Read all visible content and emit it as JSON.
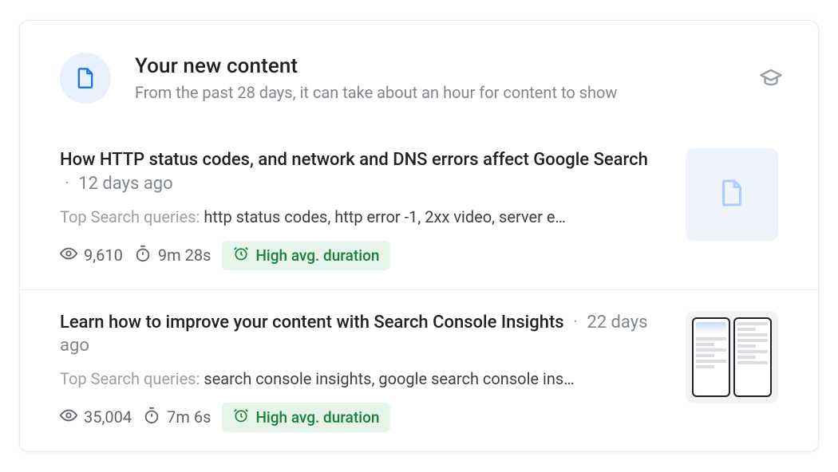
{
  "header": {
    "title": "Your new content",
    "subtitle": "From the past 28 days, it can take about an hour for content to show"
  },
  "queries_label": "Top Search queries: ",
  "items": [
    {
      "title": "How HTTP status codes, and network and DNS errors affect Google Search",
      "age": "12 days ago",
      "queries": "http status codes, http error -1, 2xx video, server e…",
      "views": "9,610",
      "duration": "9m 28s",
      "badge": "High avg. duration",
      "thumb": "doc-icon"
    },
    {
      "title": "Learn how to improve your content with Search Console Insights",
      "age": "22 days ago",
      "queries": "search console insights, google search console ins…",
      "views": "35,004",
      "duration": "7m 6s",
      "badge": "High avg. duration",
      "thumb": "screenshot"
    }
  ]
}
